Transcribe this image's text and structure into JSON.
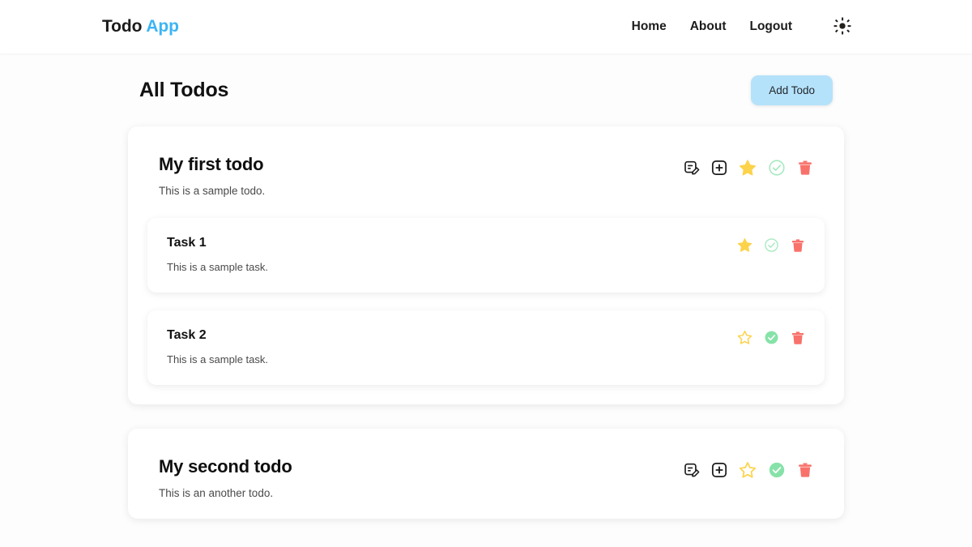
{
  "navbar": {
    "brand_primary": "Todo",
    "brand_accent": "App",
    "links": [
      {
        "label": "Home",
        "name": "nav-link-home"
      },
      {
        "label": "About",
        "name": "nav-link-about"
      },
      {
        "label": "Logout",
        "name": "nav-link-logout"
      }
    ],
    "theme_toggle_icon": "sun-icon"
  },
  "main": {
    "page_title": "All Todos",
    "add_todo_label": "Add Todo"
  },
  "todos": [
    {
      "title": "My first todo",
      "description": "This is a sample todo.",
      "favorite": true,
      "completed": false,
      "actions": [
        "edit-icon",
        "add-task-icon",
        "star-icon",
        "check-circle-icon",
        "trash-icon"
      ],
      "tasks": [
        {
          "title": "Task 1",
          "description": "This is a sample task.",
          "favorite": true,
          "completed": false,
          "actions": [
            "star-icon",
            "check-circle-icon",
            "trash-icon"
          ]
        },
        {
          "title": "Task 2",
          "description": "This is a sample task.",
          "favorite": false,
          "completed": true,
          "actions": [
            "star-icon",
            "check-circle-icon",
            "trash-icon"
          ]
        }
      ]
    },
    {
      "title": "My second todo",
      "description": "This is an another todo.",
      "favorite": false,
      "completed": true,
      "actions": [
        "edit-icon",
        "add-task-icon",
        "star-icon",
        "check-circle-icon",
        "trash-icon"
      ],
      "tasks": []
    }
  ],
  "colors": {
    "brand_accent": "#3cb4f4",
    "button_bg": "#b5e2fb",
    "star_filled": "#fcd34b",
    "star_outline": "#fcd34b",
    "check_filled": "#86e2a8",
    "check_outline": "#a6e9bf",
    "trash": "#f8726b",
    "icon_dark": "#1c1c1c",
    "text_muted": "#4a4a4a",
    "card_bg": "#ffffff",
    "page_bg": "#fdfdfd"
  }
}
